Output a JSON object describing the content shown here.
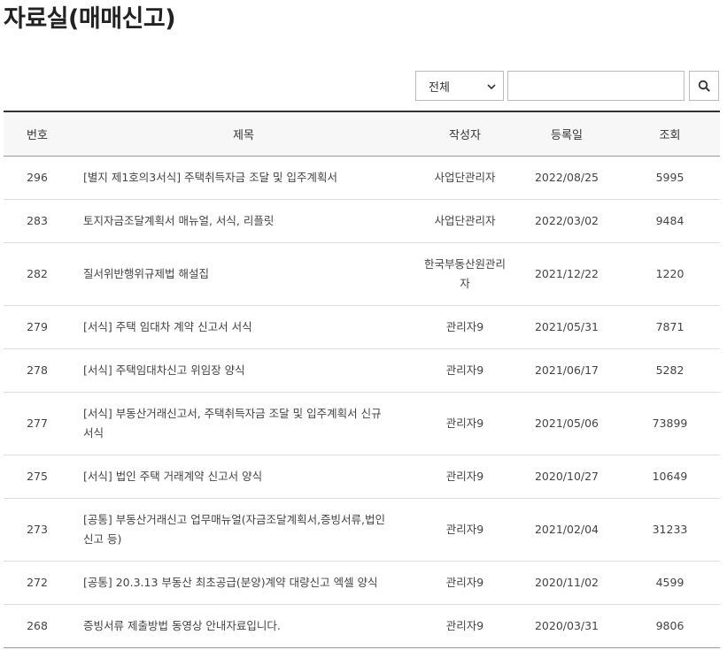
{
  "page": {
    "title": "자료실(매매신고)"
  },
  "search": {
    "category_selected": "전체",
    "query_value": "",
    "query_placeholder": ""
  },
  "table": {
    "headers": {
      "no": "번호",
      "title": "제목",
      "author": "작성자",
      "date": "등록일",
      "views": "조회"
    },
    "rows": [
      {
        "no": "296",
        "title": "[별지 제1호의3서식] 주택취득자금 조달 및 입주계획서",
        "author": "사업단관리자",
        "date": "2022/08/25",
        "views": "5995"
      },
      {
        "no": "283",
        "title": "토지자금조달계획서 매뉴얼, 서식, 리플릿",
        "author": "사업단관리자",
        "date": "2022/03/02",
        "views": "9484"
      },
      {
        "no": "282",
        "title": "질서위반행위규제법 해설집",
        "author": "한국부동산원관리자",
        "date": "2021/12/22",
        "views": "1220"
      },
      {
        "no": "279",
        "title": "[서식] 주택 임대차 계약 신고서 서식",
        "author": "관리자9",
        "date": "2021/05/31",
        "views": "7871"
      },
      {
        "no": "278",
        "title": "[서식] 주택임대차신고 위임장 양식",
        "author": "관리자9",
        "date": "2021/06/17",
        "views": "5282"
      },
      {
        "no": "277",
        "title": "[서식] 부동산거래신고서, 주택취득자금 조달 및 입주계획서 신규 서식",
        "author": "관리자9",
        "date": "2021/05/06",
        "views": "73899"
      },
      {
        "no": "275",
        "title": "[서식] 법인 주택 거래계약 신고서 양식",
        "author": "관리자9",
        "date": "2020/10/27",
        "views": "10649"
      },
      {
        "no": "273",
        "title": "[공통] 부동산거래신고 업무매뉴얼(자금조달계획서,증빙서류,법인신고 등)",
        "author": "관리자9",
        "date": "2021/02/04",
        "views": "31233"
      },
      {
        "no": "272",
        "title": "[공통] 20.3.13 부동산 최초공급(분양)계약 대량신고 엑셀 양식",
        "author": "관리자9",
        "date": "2020/11/02",
        "views": "4599"
      },
      {
        "no": "268",
        "title": "증빙서류 제출방법 동영상 안내자료입니다.",
        "author": "관리자9",
        "date": "2020/03/31",
        "views": "9806"
      }
    ]
  }
}
